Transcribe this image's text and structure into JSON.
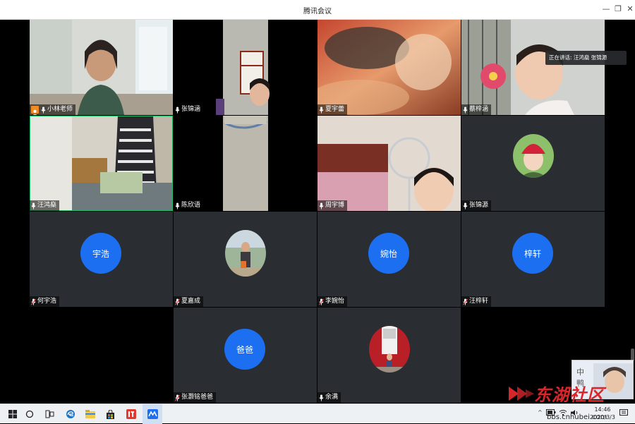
{
  "window": {
    "title": "腾讯会议"
  },
  "speaking_tip": "正在讲话: 汪鸿燊 张锦源",
  "participants": [
    {
      "name": "小林老师",
      "role": "host"
    },
    {
      "name": "张锦涵"
    },
    {
      "name": "夏宇蕾"
    },
    {
      "name": "蔡梓涵"
    },
    {
      "name": "汪鸿燊"
    },
    {
      "name": "陈欣语"
    },
    {
      "name": "周宇博"
    },
    {
      "name": "张锦源"
    },
    {
      "name": "何宇浩",
      "avatar_text": "宇浩"
    },
    {
      "name": "夏嘉成"
    },
    {
      "name": "李婉怡",
      "avatar_text": "婉怡"
    },
    {
      "name": "汪梓轩",
      "avatar_text": "梓轩"
    },
    {
      "name": "张灏铭爸爸",
      "avatar_text": "爸爸"
    },
    {
      "name": "余满"
    }
  ],
  "thumbnail": {
    "line1": "中",
    "line2": "鸭"
  },
  "watermark": {
    "text": "东湖社区",
    "url": "bbs.cnhubei.com"
  },
  "taskbar": {
    "clock_time": "14:46",
    "clock_date": "2020/3/3"
  },
  "colors": {
    "avatar_blue": "#1c6ff0",
    "tile_bg": "#2a2d31",
    "active_border": "#1fbf6a",
    "muted_mic": "#e24b4b"
  }
}
